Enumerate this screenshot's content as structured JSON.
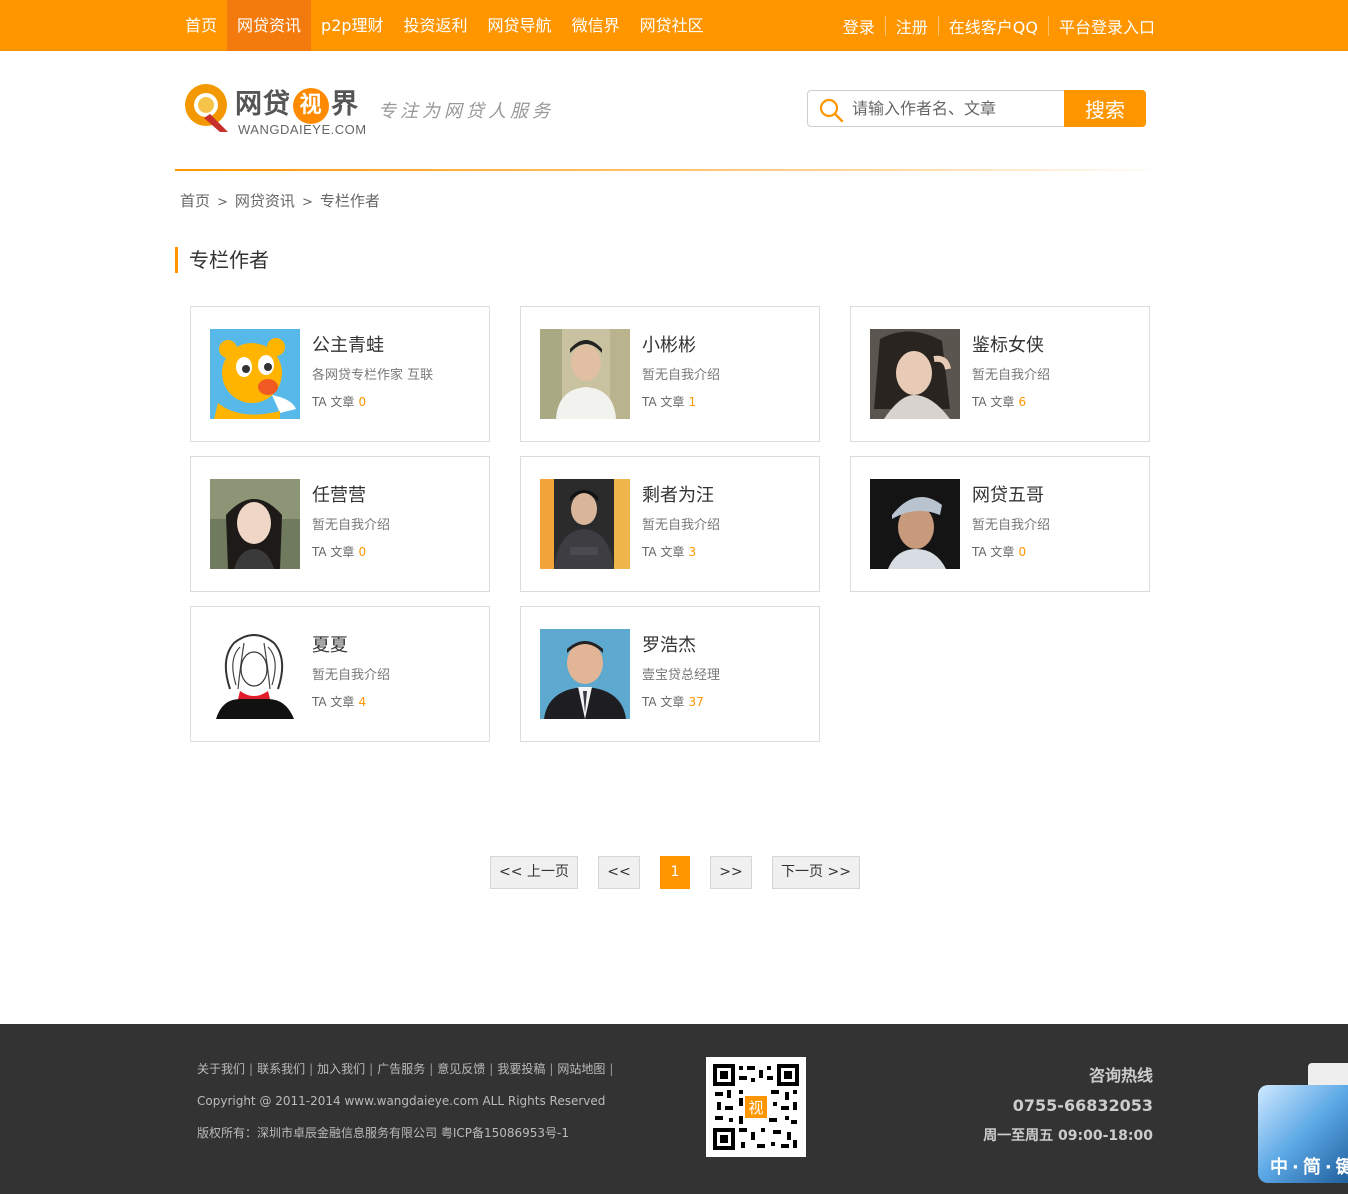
{
  "nav": {
    "items": [
      {
        "label": "首页",
        "active": false
      },
      {
        "label": "网贷资讯",
        "active": true
      },
      {
        "label": "p2p理财",
        "active": false
      },
      {
        "label": "投资返利",
        "active": false
      },
      {
        "label": "网贷导航",
        "active": false
      },
      {
        "label": "微信界",
        "active": false
      },
      {
        "label": "网贷社区",
        "active": false
      }
    ],
    "right": [
      "登录",
      "注册",
      "在线客户QQ",
      "平台登录入口"
    ]
  },
  "logo": {
    "name_a": "网贷",
    "name_eye": "视",
    "name_b": "界",
    "domain": "WANGDAIEYE.COM",
    "slogan": "专注为网贷人服务"
  },
  "search": {
    "placeholder": "请输入作者名、文章",
    "button": "搜索"
  },
  "breadcrumb": [
    "首页",
    "网贷资讯",
    "专栏作者"
  ],
  "breadcrumb_sep": ">",
  "section_title": "专栏作者",
  "count_label": "TA 文章",
  "authors": [
    {
      "name": "公主青蛙",
      "bio": "各网贷专栏作家 互联",
      "count": "0"
    },
    {
      "name": "小彬彬",
      "bio": "暂无自我介绍",
      "count": "1"
    },
    {
      "name": "鉴标女侠",
      "bio": "暂无自我介绍",
      "count": "6"
    },
    {
      "name": "任营营",
      "bio": "暂无自我介绍",
      "count": "0"
    },
    {
      "name": "剩者为汪",
      "bio": "暂无自我介绍",
      "count": "3"
    },
    {
      "name": "网贷五哥",
      "bio": "暂无自我介绍",
      "count": "0"
    },
    {
      "name": "夏夏",
      "bio": "暂无自我介绍",
      "count": "4"
    },
    {
      "name": "罗浩杰",
      "bio": "壹宝贷总经理",
      "count": "37"
    }
  ],
  "pagination": {
    "prev": "<< 上一页",
    "first": "<<",
    "current": "1",
    "last": ">>",
    "next": "下一页 >>"
  },
  "footer": {
    "links": [
      "关于我们",
      "联系我们",
      "加入我们",
      "广告服务",
      "意见反馈",
      "我要投稿",
      "网站地图"
    ],
    "link_sep": "|",
    "copyright": "Copyright @ 2011-2014 www.wangdaieye.com ALL Rights Reserved",
    "record": "版权所有：深圳市卓辰金融信息服务有限公司 粤ICP备15086953号-1",
    "hotline_title": "咨询热线",
    "phone": "0755-66832053",
    "hours": "周一至周五 09:00-18:00",
    "qr_center": "视"
  },
  "side_widget": {
    "text": "中·简·键"
  },
  "colors": {
    "accent": "#ff9600",
    "accent_dark": "#f37a0c",
    "footer": "#333333"
  }
}
